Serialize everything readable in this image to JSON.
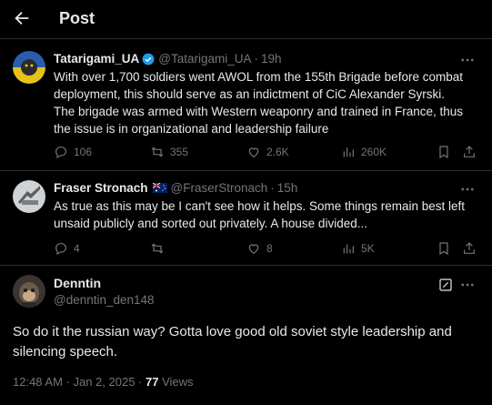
{
  "header": {
    "title": "Post"
  },
  "tweets": [
    {
      "name": "Tatarigami_UA",
      "handle": "@Tatarigami_UA",
      "time": "19h",
      "lines": [
        "With over 1,700 soldiers went AWOL from the 155th Brigade before combat",
        "deployment, this should serve as an indictment of CiC Alexander Syrski.",
        "The brigade was armed with Western weaponry and trained in France, thus",
        "the issue is in organizational and leadership failure"
      ],
      "replies": "106",
      "reposts": "355",
      "likes": "2.6K",
      "views": "260K"
    },
    {
      "name": "Fraser Stronach",
      "handle": "@FraserStronach",
      "time": "15h",
      "lines": [
        "As true as this may be I can't see how it helps. Some things remain best left",
        "unsaid publicly and sorted out privately. A house divided..."
      ],
      "replies": "4",
      "reposts": "",
      "likes": "8",
      "views": "5K"
    }
  ],
  "main": {
    "name": "Denntin",
    "handle": "@denntin_den148",
    "lines": [
      "So do it the russian way? Gotta love good old soviet style leadership and",
      "silencing speech."
    ],
    "timestamp": "12:48 AM · Jan 2, 2025 · ",
    "views_count": "77",
    "views_label": " Views"
  },
  "colors": {
    "accent": "#1d9bf0",
    "muted": "#71767b",
    "text": "#e7e9ea",
    "border": "#2f3336"
  }
}
